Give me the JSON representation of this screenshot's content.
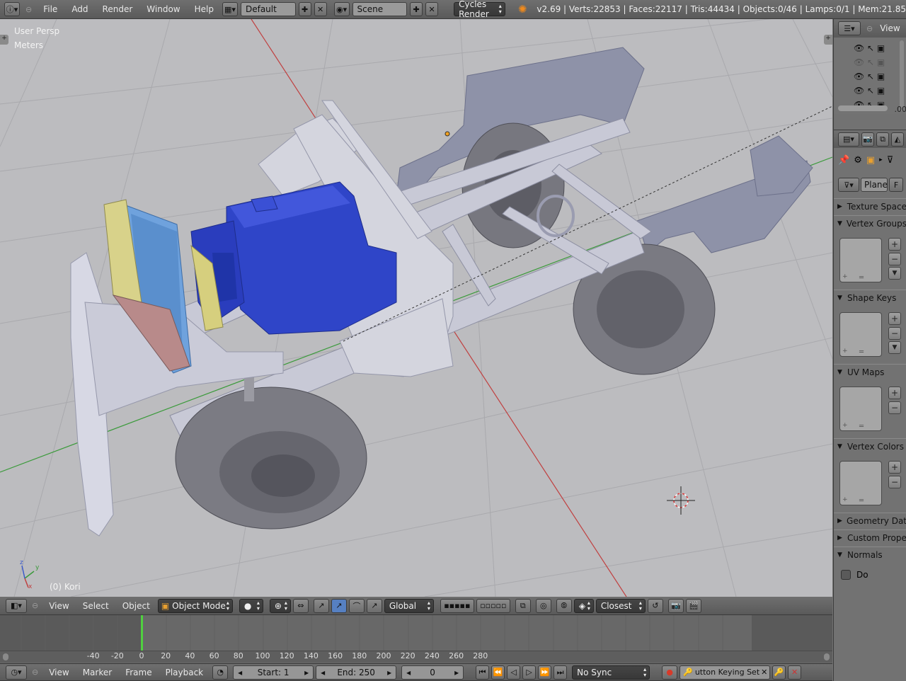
{
  "topbar": {
    "menus": [
      "File",
      "Add",
      "Render",
      "Window",
      "Help"
    ],
    "layout": "Default",
    "scene": "Scene",
    "engine": "Cycles Render",
    "stats": "v2.69 | Verts:22853 | Faces:22117 | Tris:44434 | Objects:0/46 | Lamps:0/1 | Mem:21.85"
  },
  "viewport": {
    "view_name": "User Persp",
    "units": "Meters",
    "object_label": "(0) Kori",
    "axis_x": "x",
    "axis_y": "y",
    "axis_z": "z"
  },
  "viewheader": {
    "menus": [
      "View",
      "Select",
      "Object"
    ],
    "mode": "Object Mode",
    "orientation": "Global",
    "snap": "Closest"
  },
  "outliner": {
    "view_label": "View",
    "value_fragment": ".00"
  },
  "properties": {
    "mesh_name": "Plane",
    "fake_user": "F",
    "panels": [
      {
        "label": "Texture Space",
        "open": false
      },
      {
        "label": "Vertex Groups",
        "open": true
      },
      {
        "label": "Shape Keys",
        "open": true
      },
      {
        "label": "UV Maps",
        "open": true
      },
      {
        "label": "Vertex Colors",
        "open": true
      },
      {
        "label": "Geometry Dat",
        "open": false
      },
      {
        "label": "Custom Prope",
        "open": false
      },
      {
        "label": "Normals",
        "open": true
      }
    ],
    "normals_checkbox": "Do"
  },
  "timeline": {
    "ticks": [
      "-40",
      "-20",
      "0",
      "20",
      "40",
      "60",
      "80",
      "100",
      "120",
      "140",
      "160",
      "180",
      "200",
      "220",
      "240",
      "260",
      "280"
    ],
    "current_frame_marker": 0
  },
  "timeheader": {
    "menus": [
      "View",
      "Marker",
      "Frame",
      "Playback"
    ],
    "start": "Start: 1",
    "end": "End: 250",
    "current": "0",
    "sync": "No Sync",
    "keying_set": "utton Keying Set"
  },
  "colors": {
    "engine_blue": "#2f45c8",
    "grid_red": "#c04040",
    "grid_green": "#3a9a3a"
  }
}
